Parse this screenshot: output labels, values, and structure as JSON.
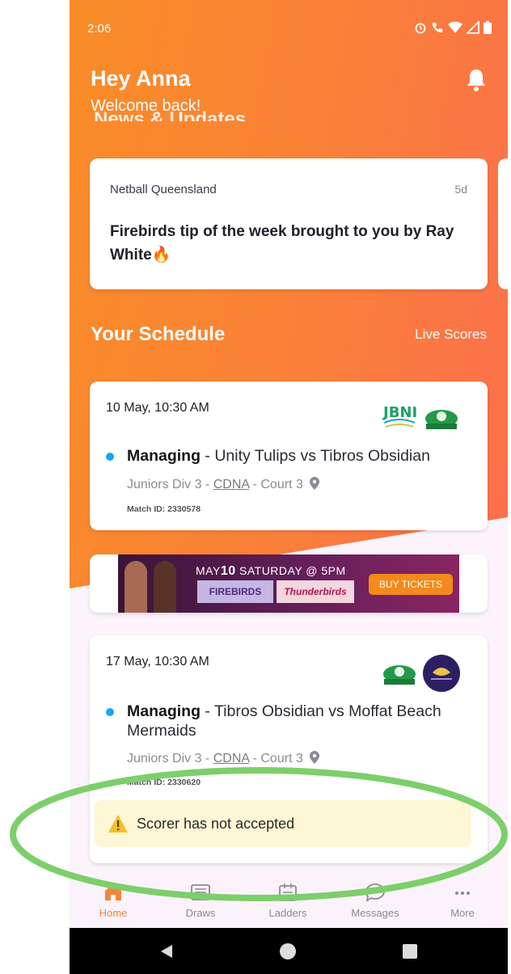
{
  "status_bar": {
    "time": "2:06"
  },
  "header": {
    "title": "Hey Anna",
    "subtitle": "Welcome back!",
    "behind_heading": "News & Updates"
  },
  "news": [
    {
      "source": "Netball Queensland",
      "age": "5d",
      "title": "Firebirds tip of the week brought to you by Ray White🔥"
    }
  ],
  "schedule": {
    "title": "Your Schedule",
    "live_scores_label": "Live Scores",
    "matches": [
      {
        "datetime": "10 May, 10:30 AM",
        "role": "Managing",
        "separator": " - ",
        "teams": "Unity Tulips vs Tibros Obsidian",
        "division": "Juniors Div 3 - ",
        "venue": "CDNA",
        "court": " - Court 3",
        "match_id": "Match ID: 2330578"
      },
      {
        "datetime": "17 May, 10:30 AM",
        "role": "Managing",
        "separator": " - ",
        "teams": "Tibros Obsidian vs Moffat Beach Mermaids",
        "division": "Juniors Div 3 - ",
        "venue": "CDNA",
        "court": " - Court 3",
        "match_id": "Match ID: 2330620",
        "warning": "Scorer has not accepted"
      }
    ]
  },
  "ad_banner": {
    "date_line_prefix": "MAY",
    "date_line_day": "10",
    "date_line_rest": " SATURDAY @ 5PM",
    "team_a": "FIREBIRDS",
    "team_b": "Thunderbirds",
    "cta": "BUY TICKETS"
  },
  "tabs": [
    {
      "label": "Home",
      "icon": "home-icon",
      "active": true
    },
    {
      "label": "Draws",
      "icon": "draws-icon"
    },
    {
      "label": "Ladders",
      "icon": "ladders-icon"
    },
    {
      "label": "Messages",
      "icon": "messages-icon"
    },
    {
      "label": "More",
      "icon": "more-icon"
    }
  ],
  "colors": {
    "accent": "#f5843a",
    "hero_start": "#f98c27",
    "hero_end": "#fb6f4d",
    "dot": "#14a8f0",
    "warning_bg": "#fdf7d6",
    "highlight_ellipse": "#7ccf6a"
  }
}
